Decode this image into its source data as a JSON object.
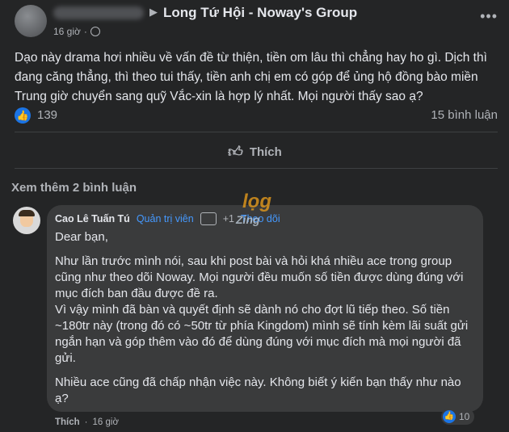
{
  "post": {
    "group_name": "Long Tứ Hội - Noway's Group",
    "time": "16 giờ",
    "text": "Dạo này drama hơi nhiều về vấn đề từ thiện, tiền om lâu thì chẳng hay ho gì. Dịch thì đang căng thẳng, thì theo tui thấy, tiền anh chị em có góp để ủng hộ đồng bào miền Trung giờ chuyển sang quỹ Vắc-xin là hợp lý nhất. Mọi người thấy sao ạ?",
    "like_count": "139",
    "comment_count": "15 bình luận",
    "like_button": "Thích",
    "view_more_comments": "Xem thêm 2 bình luận"
  },
  "comment": {
    "author": "Cao Lê Tuấn Tú",
    "role": "Quản trị viên",
    "badge_count": "+1",
    "follow": "Theo dõi",
    "paragraphs": [
      "Dear bạn,",
      "Như lần trước mình nói, sau khi post bài và hỏi khá nhiều ace trong group cũng như theo dõi Noway. Mọi người đều muốn số tiền được dùng đúng với mục đích ban đầu được đề ra.\nVì vậy mình đã bàn và quyết định sẽ dành nó cho đợt lũ tiếp theo. Số tiền ~180tr này (trong đó có ~50tr từ phía Kingdom) mình sẽ tính kèm lãi suất gửi ngắn hạn và góp thêm vào đó để dùng đúng với mục đích mà mọi người đã gửi.",
      "Nhiều ace cũng đã chấp nhận việc này. Không biết ý kiến bạn thấy như nào ạ?"
    ],
    "action_like": "Thích",
    "time": "16 giờ",
    "reaction_count": "10"
  },
  "watermark": {
    "line1": "lọg",
    "line2": "Zing"
  },
  "colors": {
    "background": "#242526",
    "bubble": "#3a3b3c",
    "link": "#4599ff",
    "like_blue": "#1b74e4",
    "watermark_orange": "#f0a11a"
  },
  "icons": [
    "globe-icon",
    "more-icon",
    "like-reaction-icon",
    "thumbs-up-icon",
    "admin-badge-icon"
  ]
}
